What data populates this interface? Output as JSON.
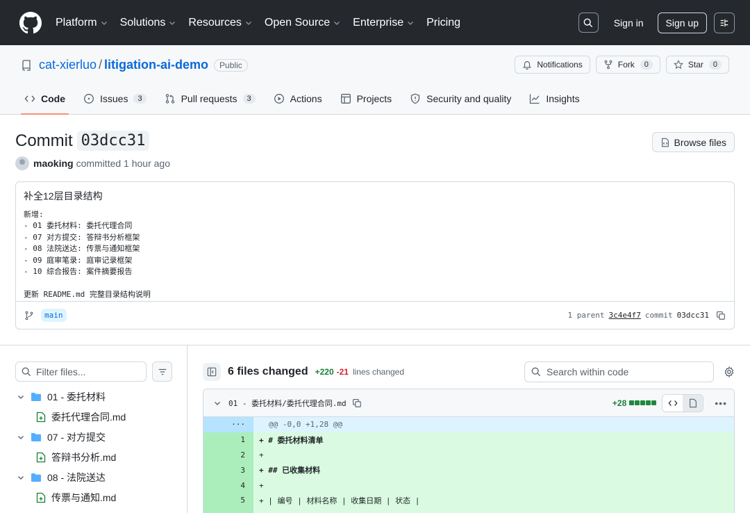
{
  "header": {
    "nav": [
      "Platform",
      "Solutions",
      "Resources",
      "Open Source",
      "Enterprise",
      "Pricing"
    ],
    "sign_in": "Sign in",
    "sign_up": "Sign up"
  },
  "repo": {
    "owner": "cat-xierluo",
    "name": "litigation-ai-demo",
    "visibility": "Public",
    "notifications_label": "Notifications",
    "fork_label": "Fork",
    "fork_count": "0",
    "star_label": "Star",
    "star_count": "0"
  },
  "tabs": [
    {
      "label": "Code",
      "count": ""
    },
    {
      "label": "Issues",
      "count": "3"
    },
    {
      "label": "Pull requests",
      "count": "3"
    },
    {
      "label": "Actions",
      "count": ""
    },
    {
      "label": "Projects",
      "count": ""
    },
    {
      "label": "Security and quality",
      "count": ""
    },
    {
      "label": "Insights",
      "count": ""
    }
  ],
  "commit": {
    "title_prefix": "Commit",
    "sha_short": "03dcc31",
    "browse_files": "Browse files",
    "author": "maoking",
    "committed_text": "committed 1 hour ago",
    "message_title": "补全12层目录结构",
    "message_body": "新增:\n- 01 委托材料: 委托代理合同\n- 07 对方提交: 答辩书分析框架\n- 08 法院送达: 传票与通知框架\n- 09 庭审笔录: 庭审记录框架\n- 10 综合报告: 案件摘要报告\n\n更新 README.md 完整目录结构说明",
    "branch": "main",
    "parent_label": "1 parent",
    "parent_sha": "3c4e4f7",
    "commit_label": "commit",
    "commit_sha": "03dcc31"
  },
  "file_tree": {
    "filter_placeholder": "Filter files...",
    "items": [
      {
        "type": "dir",
        "label": "01 - 委托材料"
      },
      {
        "type": "file",
        "label": "委托代理合同.md"
      },
      {
        "type": "dir",
        "label": "07 - 对方提交"
      },
      {
        "type": "file",
        "label": "答辩书分析.md"
      },
      {
        "type": "dir",
        "label": "08 - 法院送达"
      },
      {
        "type": "file",
        "label": "传票与通知.md"
      }
    ]
  },
  "diff": {
    "files_changed": "6 files changed",
    "additions": "+220",
    "deletions": "-21",
    "lines_changed": "lines changed",
    "search_placeholder": "Search within code",
    "file": {
      "path": "01 - 委托材料/委托代理合同.md",
      "stat": "+28",
      "hunk": "@@ -0,0 +1,28 @@",
      "lines": [
        {
          "num": "1",
          "code": "+ # 委托材料清单",
          "heading": true
        },
        {
          "num": "2",
          "code": "+",
          "heading": false
        },
        {
          "num": "3",
          "code": "+ ## 已收集材料",
          "heading": true
        },
        {
          "num": "4",
          "code": "+",
          "heading": false
        },
        {
          "num": "5",
          "code": "+ | 编号 | 材料名称 | 收集日期 | 状态 |",
          "heading": false
        }
      ]
    }
  },
  "colors": {
    "header_bg": "#25292e",
    "link": "#0969da",
    "add_green": "#1a7f37",
    "del_red": "#d1242f",
    "tab_underline": "#fd8c73"
  }
}
